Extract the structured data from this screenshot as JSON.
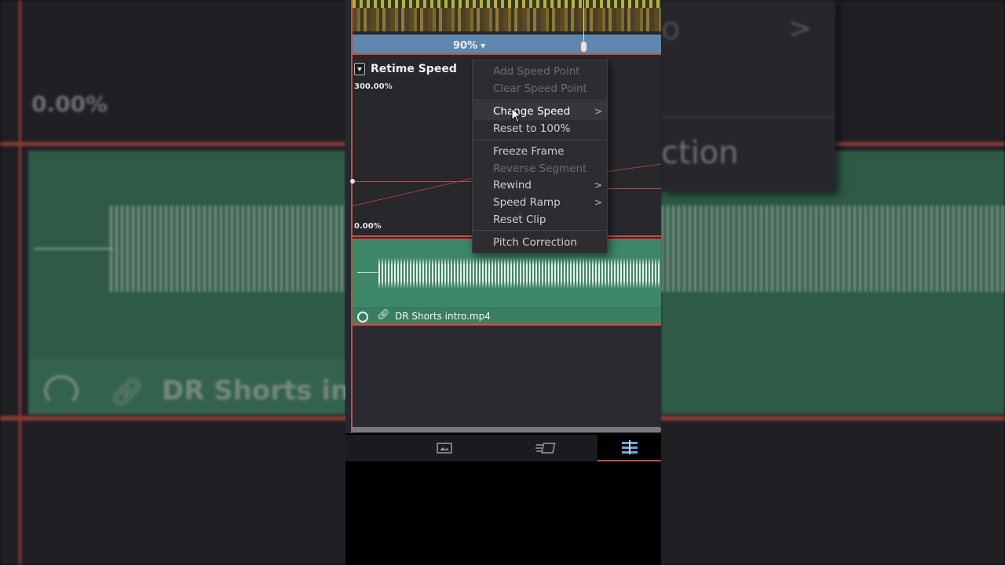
{
  "background": {
    "percent_label": "0.00%",
    "clip_name_partial": "DR Shorts int",
    "menu_partial_text": "ction",
    "partial_o": "o"
  },
  "timeline": {
    "speed_label": "90%",
    "retime_title": "Retime Speed",
    "y_max": "300.00%",
    "y_min": "0.00%",
    "clip_name": "DR Shorts intro.mp4"
  },
  "context_menu": {
    "items": [
      {
        "label": "Add Speed Point",
        "enabled": false
      },
      {
        "label": "Clear Speed Point",
        "enabled": false
      },
      {
        "label": "Change Speed",
        "enabled": true,
        "submenu": true,
        "highlighted": true
      },
      {
        "label": "Reset to 100%",
        "enabled": true
      },
      {
        "label": "Freeze Frame",
        "enabled": true
      },
      {
        "label": "Reverse Segment",
        "enabled": false
      },
      {
        "label": "Rewind",
        "enabled": true,
        "submenu": true
      },
      {
        "label": "Speed Ramp",
        "enabled": true,
        "submenu": true
      },
      {
        "label": "Reset Clip",
        "enabled": true
      },
      {
        "label": "Pitch Correction",
        "enabled": true
      }
    ]
  },
  "bottom_tabs": [
    {
      "icon": "media-pool-icon",
      "active": false
    },
    {
      "icon": "effects-icon",
      "active": false
    },
    {
      "icon": "inspector-icon",
      "active": true
    }
  ],
  "colors": {
    "accent_red": "#c0504a",
    "speed_bar_blue": "#5f86ad",
    "audio_green": "#3d8768",
    "active_tab_blue": "#6aa6d8"
  }
}
